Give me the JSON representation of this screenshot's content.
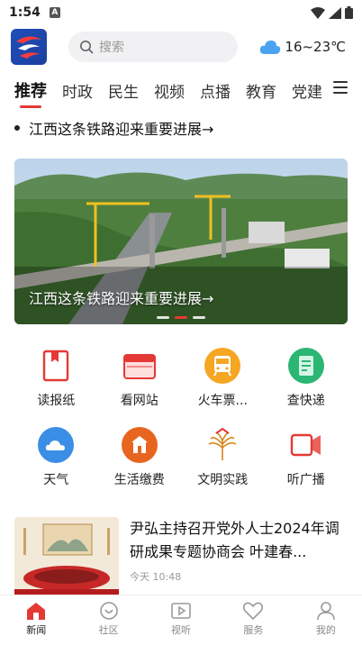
{
  "status_bar": {
    "time": "1:54",
    "notification_badge": "A"
  },
  "header": {
    "search_placeholder": "搜索",
    "weather_text": "16~23℃",
    "weather_icon": "cloud-icon"
  },
  "tabs": [
    {
      "label": "推荐",
      "active": true
    },
    {
      "label": "时政",
      "active": false
    },
    {
      "label": "民生",
      "active": false
    },
    {
      "label": "视频",
      "active": false
    },
    {
      "label": "点播",
      "active": false
    },
    {
      "label": "教育",
      "active": false
    },
    {
      "label": "党建",
      "active": false
    }
  ],
  "ticker": {
    "text": "江西这条铁路迎来重要进展→"
  },
  "banner": {
    "caption": "江西这条铁路迎来重要进展→",
    "slide_count": 3,
    "active_slide": 2
  },
  "quick_links": [
    {
      "label": "读报纸",
      "icon": "newspaper-icon",
      "color": "#e53935"
    },
    {
      "label": "看网站",
      "icon": "browser-icon",
      "color": "#e53935"
    },
    {
      "label": "火车票...",
      "icon": "train-icon",
      "color": "#f5a623"
    },
    {
      "label": "查快递",
      "icon": "package-icon",
      "color": "#2bb673"
    },
    {
      "label": "天气",
      "icon": "weather-icon",
      "color": "#3a8ee6"
    },
    {
      "label": "生活缴费",
      "icon": "bill-icon",
      "color": "#e8651f"
    },
    {
      "label": "文明实践",
      "icon": "civility-icon",
      "color": "#d8861b"
    },
    {
      "label": "听广播",
      "icon": "radio-icon",
      "color": "#e53935"
    }
  ],
  "news": [
    {
      "title": "尹弘主持召开党外人士2024年调研成果专题协商会 叶建春...",
      "time": "今天 10:48"
    }
  ],
  "bottom_nav": [
    {
      "label": "新闻",
      "icon": "home-icon",
      "active": true
    },
    {
      "label": "社区",
      "icon": "community-icon",
      "active": false
    },
    {
      "label": "视听",
      "icon": "video-icon",
      "active": false
    },
    {
      "label": "服务",
      "icon": "heart-icon",
      "active": false
    },
    {
      "label": "我的",
      "icon": "profile-icon",
      "active": false
    }
  ],
  "colors": {
    "accent": "#e53935"
  }
}
